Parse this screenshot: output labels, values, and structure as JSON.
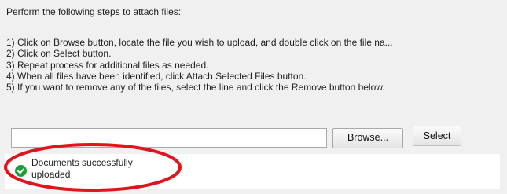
{
  "instructions": {
    "heading": "Perform the following steps to attach files:",
    "steps": [
      "1) Click on Browse button, locate the file you wish to upload, and double click on the file na...",
      "2) Click on Select button.",
      "3) Repeat process for additional files as needed.",
      "4) When all files have been identified, click Attach Selected Files button.",
      "5) If you want to remove any of the files,  select the line and click the Remove button below."
    ]
  },
  "upload": {
    "file_path_value": "",
    "browse_label": "Browse...",
    "select_label": "Select"
  },
  "status": {
    "line1": "Documents successfully",
    "line2": "uploaded",
    "icon": "check-circle-icon",
    "color": "#1f9d3a"
  },
  "annotation": {
    "color": "#e0141c"
  }
}
